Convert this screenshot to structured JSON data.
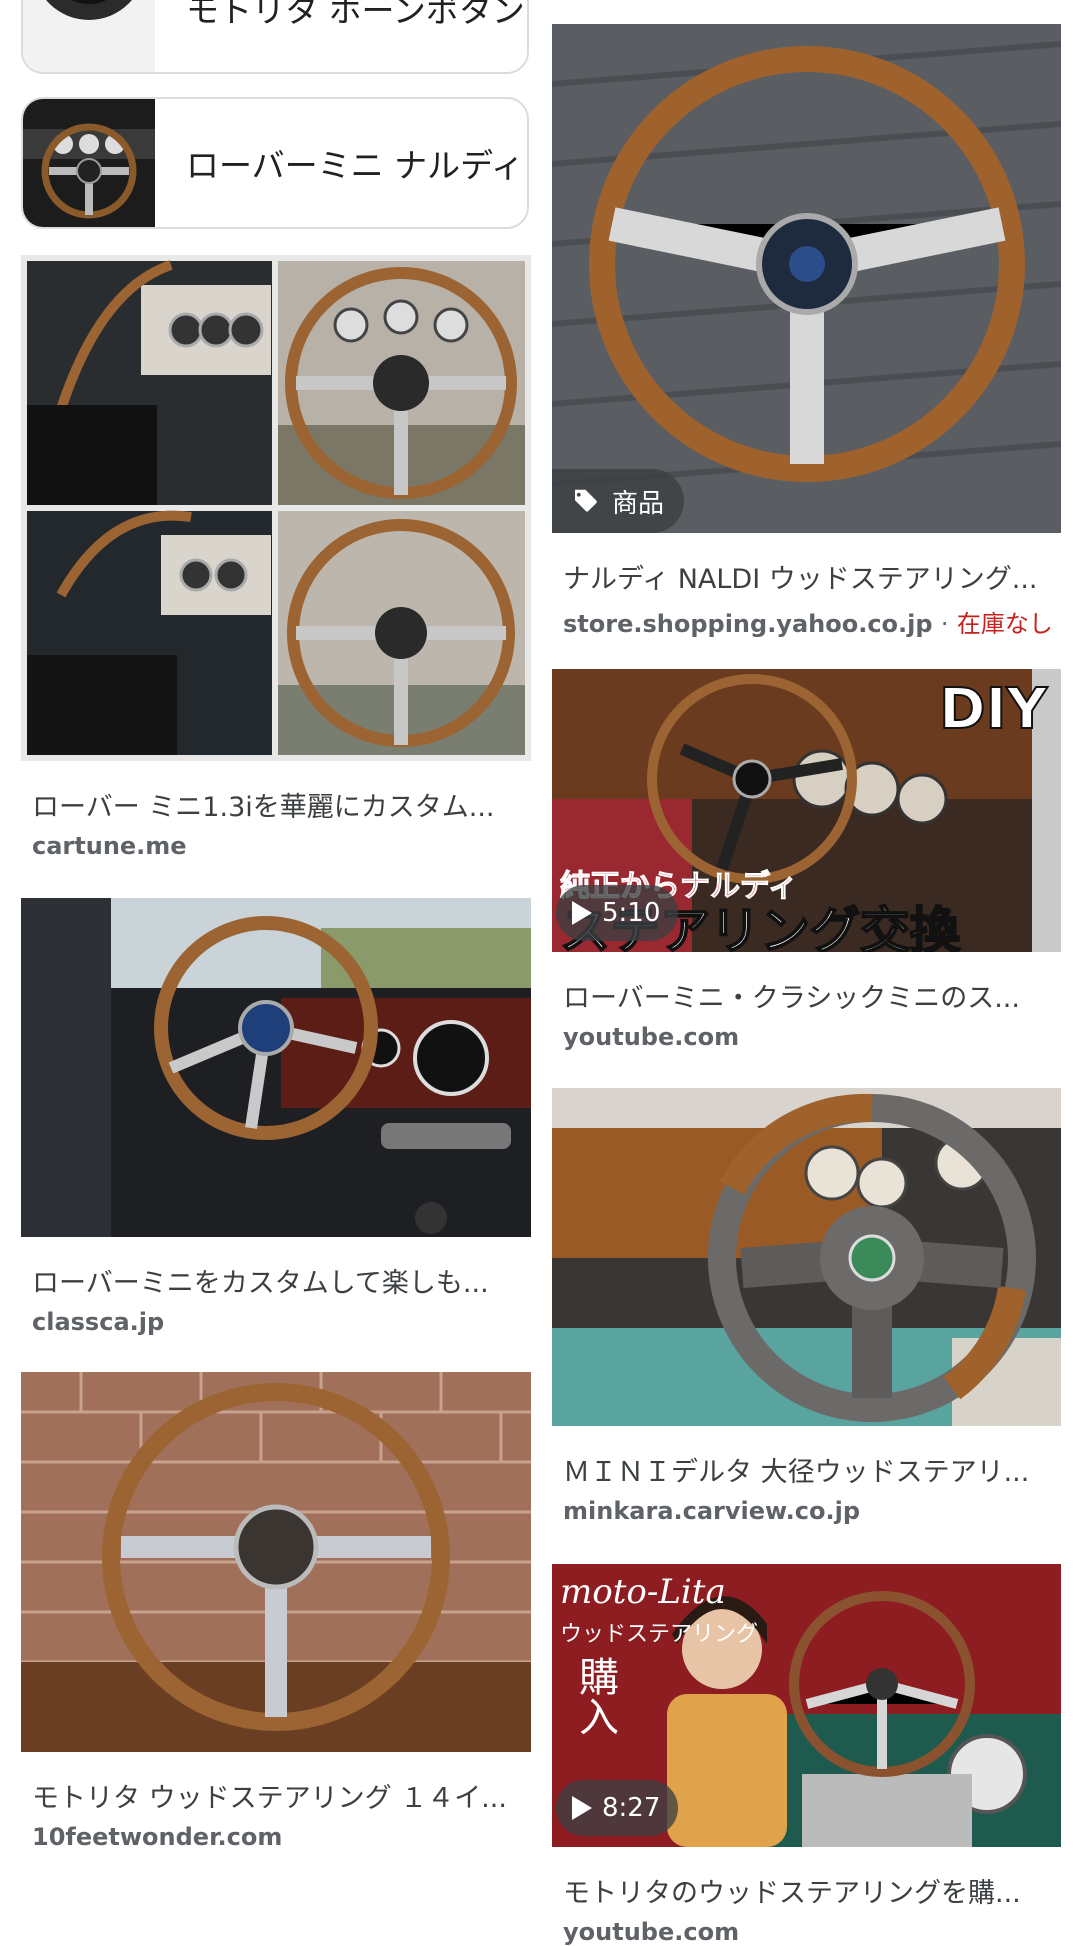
{
  "chips": [
    {
      "label": "モトリタ ホーンボタン"
    },
    {
      "label": "ローバーミニ ナルディ"
    }
  ],
  "left_results": [
    {
      "title": "ローバー ミニ1.3iを華麗にカスタム...",
      "source": "cartune.me"
    },
    {
      "title": "ローバーミニをカスタムして楽しも...",
      "source": "classca.jp"
    },
    {
      "title": "モトリタ ウッドステアリング １４イ...",
      "source": "10feetwonder.com"
    }
  ],
  "right_results": [
    {
      "title": "ナルディ NALDI ウッドステアリング...",
      "source": "store.shopping.yahoo.co.jp",
      "separator": "·",
      "stock": "在庫なし",
      "badge": "商品"
    },
    {
      "title": "ローバーミニ・クラシックミニのス...",
      "source": "youtube.com",
      "duration": "5:10",
      "overlay_top": "DIY",
      "overlay_red": "純正からナルディ",
      "overlay_white": "ステアリング交換"
    },
    {
      "title": "ＭＩＮＩデルタ 大径ウッドステアリ...",
      "source": "minkara.carview.co.jp"
    },
    {
      "title": "モトリタのウッドステアリングを購...",
      "source": "youtube.com",
      "duration": "8:27",
      "overlay_script": "moto-Lita",
      "overlay_sub": "ウッドステアリング",
      "overlay_buy": "購入"
    }
  ],
  "colors": {
    "accent_red": "#c5221f",
    "wood": "#a0622d",
    "chip_border": "#dadce0"
  }
}
